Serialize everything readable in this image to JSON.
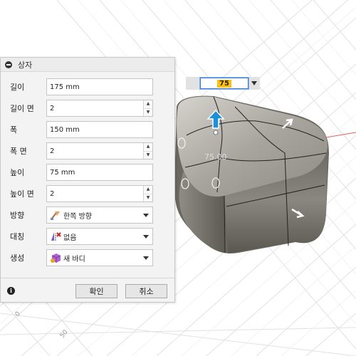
{
  "dialog": {
    "title": "상자",
    "rows": [
      {
        "label": "길이",
        "value": "175 mm"
      },
      {
        "label": "길이 면",
        "value": "2"
      },
      {
        "label": "폭",
        "value": "150 mm"
      },
      {
        "label": "폭 면",
        "value": "2"
      },
      {
        "label": "높이",
        "value": "75 mm"
      },
      {
        "label": "높이 면",
        "value": "2"
      }
    ],
    "direction": {
      "label": "방향",
      "value": "한쪽 방향",
      "icon": "one-direction-icon"
    },
    "symmetry": {
      "label": "대칭",
      "value": "없음",
      "icon": "symmetry-none-icon"
    },
    "operation": {
      "label": "생성",
      "value": "새 바디",
      "icon": "new-body-icon"
    },
    "ok_label": "확인",
    "cancel_label": "취소"
  },
  "viewport": {
    "dimension_input": "75",
    "dimension_label": "75.00",
    "grid_ruler_labels": [
      "0",
      "50"
    ]
  },
  "colors": {
    "accent": "#3a7bd5",
    "highlight": "#ffc107",
    "manipulator_arrow": "#1e90d8"
  }
}
